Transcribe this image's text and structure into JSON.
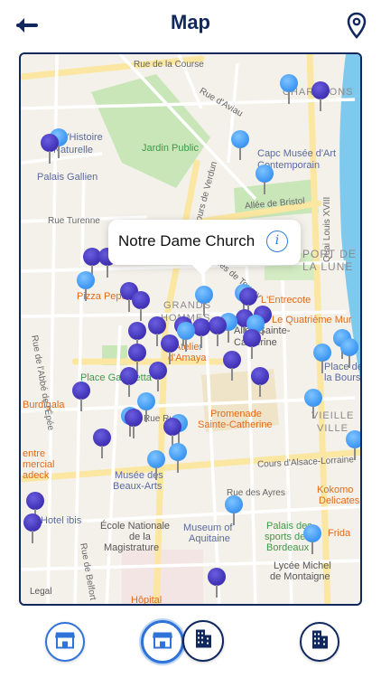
{
  "header": {
    "title": "Map",
    "back_icon": "back-arrow-icon",
    "location_icon": "map-pin-icon"
  },
  "colors": {
    "navy": "#10285e",
    "marker_light": "#3a94f2",
    "marker_dark": "#3f2fb3",
    "accent": "#2e7de0"
  },
  "callout": {
    "title": "Notre Dame Church",
    "info_icon": "info-icon"
  },
  "map_labels": {
    "rue_course": "Rue de la Course",
    "rue_avau": "Rue d'Aviau",
    "chartrons": "CHARTRONS",
    "histoire_1": "ée d'Histoire",
    "histoire_2": "Naturelle",
    "jardin": "Jardin Public",
    "capc_1": "Capc Musée d'Art",
    "capc_2": "Contemporain",
    "palais_gallien": "Palais Gallien",
    "cours_verdun": "Cours de Verdun",
    "allee_bristol": "Allée de Bristol",
    "quai": "Quai Louis XVIII",
    "rue_turenne": "Rue Turenne",
    "port_1": "PORT DE",
    "port_2": "LA LUNE",
    "rue_epee": "Rue de l'Abbé de l'Épée",
    "pizza": "Pizza Pepe",
    "tourny": "Allées de Tourny",
    "grands_1": "GRANDS",
    "grands_2": "HOMMES",
    "entrecote": "L'Entrecote",
    "quatrieme": "Le Quatrième Mur",
    "atelier_1": "Atelier",
    "atelier_2": "d'Amaya",
    "sainte_1": "Allée Sainte-",
    "sainte_2": "Catherine",
    "place_gambetta": "Place Gambetta",
    "bourse_1": "Place de",
    "bourse_2": "la Bourse",
    "burdigala": "Burdigala",
    "rue_ruat": "Rue Ruat",
    "promenade_1": "Promenade",
    "promenade_2": "Sainte-Catherine",
    "vieille_1": "VIEILLE",
    "vieille_2": "VILLE",
    "centre_1": "entre",
    "centre_2": "mercial",
    "centre_3": "adeck",
    "alsace": "Cours d'Alsace-Lorraine",
    "musee_ba_1": "Musée des",
    "musee_ba_2": "Beaux-Arts",
    "rue_ayres": "Rue des Ayres",
    "kokomo_1": "Kokomo",
    "kokomo_2": "Delicates",
    "hotel_ibis": "Hotel ibis",
    "ecole_1": "École Nationale",
    "ecole_2": "de la",
    "ecole_3": "Magistrature",
    "museum_1": "Museum of",
    "museum_2": "Aquitaine",
    "palais_sports_1": "Palais des",
    "palais_sports_2": "sports de",
    "palais_sports_3": "Bordeaux",
    "frida": "Frida",
    "rue_belfort": "Rue de Belfort",
    "lycee_1": "Lycée Michel",
    "lycee_2": "de Montaigne",
    "hopital": "Hôpital",
    "legal": "Legal"
  },
  "bottom_bar": {
    "left_icon": "shop-icon",
    "middle_icons": [
      "shop-icon",
      "building-icon"
    ],
    "right_icon": "building-icon"
  }
}
